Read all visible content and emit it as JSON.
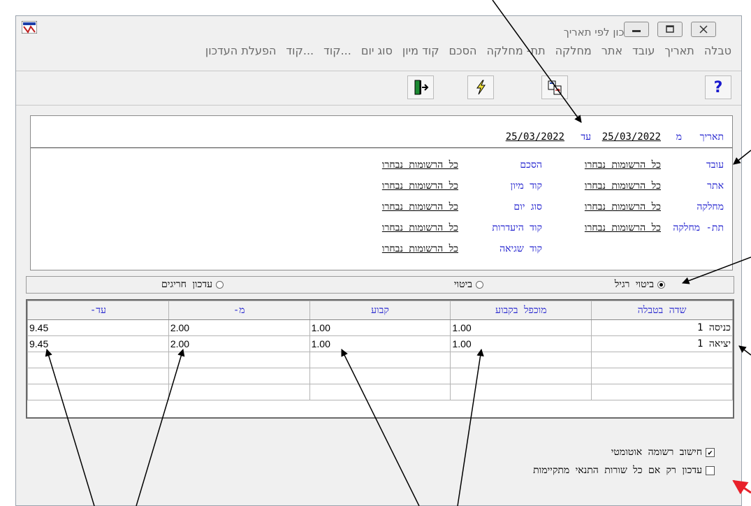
{
  "window": {
    "title": "עדכון לפי תאריך"
  },
  "menu": [
    "טבלה",
    "תאריך",
    "עובד",
    "אתר",
    "מחלקה",
    "תת- מחלקה",
    "הסכם",
    "קוד מיון",
    "סוג יום",
    "קוד...",
    "קוד...",
    "הפעלת העדכון"
  ],
  "toolbar": {
    "help_label": "?"
  },
  "filter": {
    "date_label": "תאריך",
    "from_label": "מ",
    "from_date": "25/03/2022",
    "to_label": "עד",
    "to_date": "25/03/2022",
    "all_records": "כל הרשומות נבחרו",
    "col1": [
      "עובד",
      "אתר",
      "מחלקה",
      "תת- מחלקה"
    ],
    "col2": [
      "הסכם",
      "קוד מיון",
      "סוג יום",
      "קוד היעדרות",
      "קוד שגיאה"
    ]
  },
  "radios": {
    "regular": "ביטוי רגיל",
    "expression": "ביטוי",
    "exceptions": "עדכון חריגים",
    "selected": "regular"
  },
  "grid": {
    "headers": [
      "שדה בטבלה",
      "מוכפל בקבוע",
      "קבוע",
      "מ-",
      "עד-"
    ],
    "rows": [
      [
        "כניסה 1",
        "1.00",
        "1.00",
        "2.00",
        "9.45"
      ],
      [
        "יציאה 1",
        "1.00",
        "1.00",
        "2.00",
        "9.45"
      ],
      [
        "",
        "",
        "",
        "",
        ""
      ],
      [
        "",
        "",
        "",
        "",
        ""
      ],
      [
        "",
        "",
        "",
        "",
        ""
      ]
    ]
  },
  "options": {
    "auto_calc": {
      "label": "חישוב רשומה אוטומטי",
      "checked": true
    },
    "all_conditions": {
      "label": "עדכון רק אם כל שורות התנאי מתקיימות",
      "checked": false
    }
  },
  "colors": {
    "label_blue": "#1a1acd",
    "annotation_red": "#e8202a"
  }
}
